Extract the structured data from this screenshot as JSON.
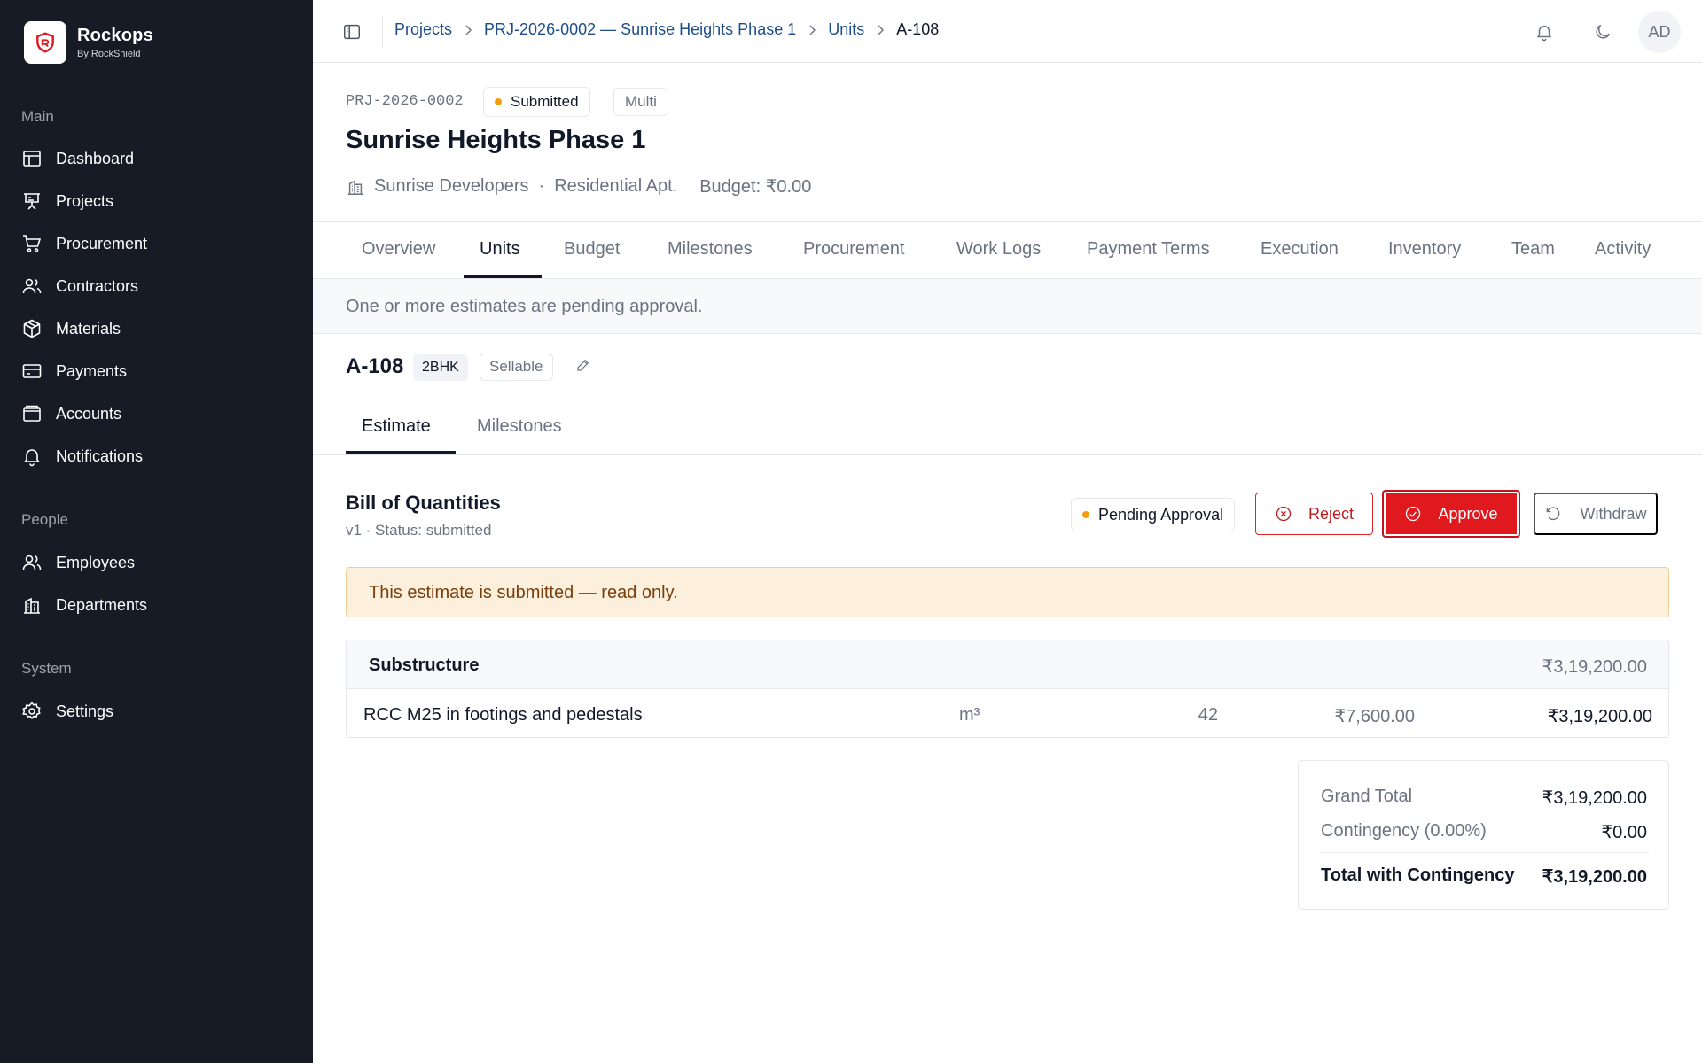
{
  "brand": {
    "name": "Rockops",
    "sub": "By RockShield"
  },
  "sidebar": {
    "sections": [
      {
        "label": "Main",
        "items": [
          "Dashboard",
          "Projects",
          "Procurement",
          "Contractors",
          "Materials",
          "Payments",
          "Accounts",
          "Notifications"
        ]
      },
      {
        "label": "People",
        "items": [
          "Employees",
          "Departments"
        ]
      },
      {
        "label": "System",
        "items": [
          "Settings"
        ]
      }
    ]
  },
  "breadcrumb": [
    "Projects",
    "PRJ-2026-0002 — Sunrise Heights Phase 1",
    "Units",
    "A-108"
  ],
  "user": {
    "initials": "AD"
  },
  "project": {
    "code": "PRJ-2026-0002",
    "status": "Submitted",
    "mode": "Multi",
    "title": "Sunrise Heights Phase 1",
    "developer": "Sunrise Developers",
    "separator": "·",
    "type": "Residential Apt.",
    "budget": "Budget: ₹0.00"
  },
  "tabs": [
    "Overview",
    "Units",
    "Budget",
    "Milestones",
    "Procurement",
    "Work Logs",
    "Payment Terms",
    "Execution",
    "Inventory",
    "Team",
    "Activity"
  ],
  "pending_notice": "One or more estimates are pending approval.",
  "unit": {
    "code": "A-108",
    "type": "2BHK",
    "badge": "Sellable"
  },
  "subtabs": [
    "Estimate",
    "Milestones"
  ],
  "boq": {
    "title": "Bill of Quantities",
    "subtitle": "v1 · Status: submitted",
    "status": "Pending Approval",
    "actions": {
      "reject": "Reject",
      "approve": "Approve",
      "withdraw": "Withdraw"
    },
    "readonly_notice": "This estimate is submitted — read only.",
    "section": {
      "name": "Substructure",
      "total": "₹3,19,200.00"
    },
    "item": {
      "description": "RCC M25 in footings and pedestals",
      "unit": "m³",
      "qty": "42",
      "rate": "₹7,600.00",
      "amount": "₹3,19,200.00"
    },
    "totals": {
      "grand_label": "Grand Total",
      "grand_value": "₹3,19,200.00",
      "contingency_label": "Contingency (0.00%)",
      "contingency_value": "₹0.00",
      "total_label": "Total with Contingency",
      "total_value": "₹3,19,200.00"
    }
  },
  "colors": {
    "sidebar_bg": "#171b26",
    "link": "#1e4d8c",
    "danger": "#e0191f",
    "warning_dot": "#f59e0b",
    "alert_bg": "#fcefdc"
  }
}
